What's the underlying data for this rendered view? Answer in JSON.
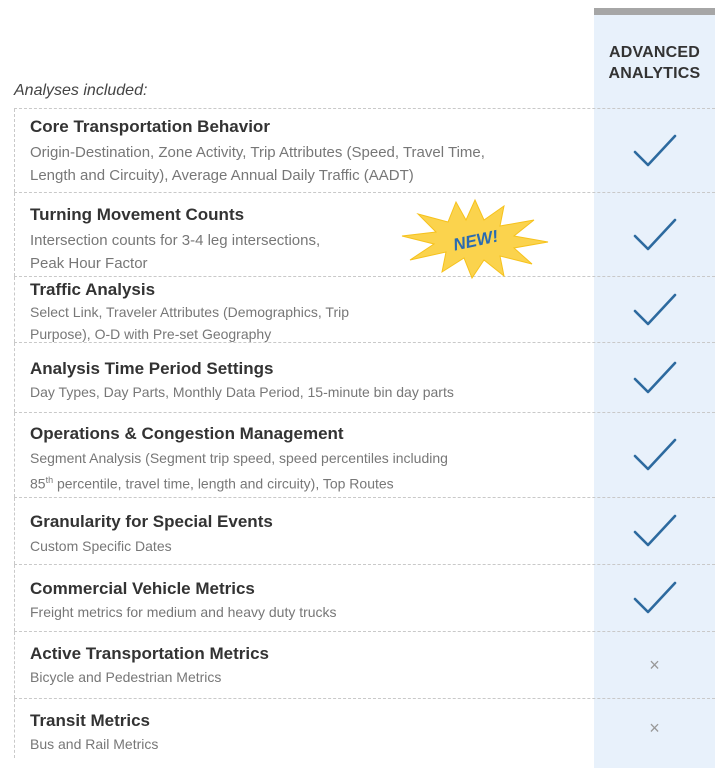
{
  "header": {
    "column_title_line1": "ADVANCED",
    "column_title_line2": "ANALYTICS",
    "analyses_label": "Analyses included:"
  },
  "badge": {
    "text": "NEW!",
    "color": "#fbd34d"
  },
  "colors": {
    "check": "#2d6a9f",
    "column_bg": "#e8f1fb",
    "cross": "#999999"
  },
  "rows": [
    {
      "title": "Core Transportation Behavior",
      "desc1": "Origin-Destination, Zone Activity, Trip Attributes (Speed, Travel Time,",
      "desc2": "Length and Circuity), Average Annual Daily Traffic (AADT)",
      "included": true
    },
    {
      "title": "Turning Movement Counts",
      "desc1": "Intersection counts for 3-4 leg intersections,",
      "desc2": "Peak Hour Factor",
      "included": true
    },
    {
      "title": "Traffic Analysis",
      "desc1": "Select Link, Traveler Attributes (Demographics, Trip",
      "desc2": "Purpose), O-D with Pre-set Geography",
      "included": true
    },
    {
      "title": "Analysis Time Period Settings",
      "desc1": "Day Types, Day Parts, Monthly Data Period, 15-minute bin day parts",
      "included": true
    },
    {
      "title": "Operations & Congestion Management",
      "desc1": "Segment Analysis (Segment trip speed, speed percentiles including",
      "desc2_prefix": "85",
      "desc2_sup": "th",
      "desc2": " percentile, travel time, length and circuity), Top Routes",
      "included": true
    },
    {
      "title": "Granularity for Special Events",
      "desc1": "Custom Specific Dates",
      "included": true
    },
    {
      "title": "Commercial Vehicle Metrics",
      "desc1": "Freight metrics for medium and heavy duty trucks",
      "included": true
    },
    {
      "title": "Active Transportation Metrics",
      "desc1": "Bicycle and Pedestrian Metrics",
      "included": false
    },
    {
      "title": "Transit Metrics",
      "desc1": "Bus and Rail Metrics",
      "included": false
    }
  ],
  "cross_symbol": "×"
}
